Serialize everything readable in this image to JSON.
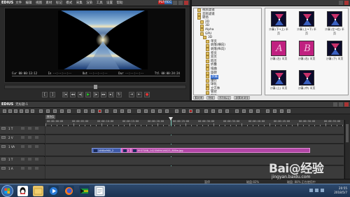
{
  "player": {
    "app_name": "EDIUS",
    "menu": [
      "文件",
      "编辑",
      "视图",
      "素材",
      "标记",
      "模式",
      "采集",
      "渲染",
      "工具",
      "设置",
      "帮助"
    ],
    "mode_badge_a": "PLR",
    "mode_badge_b": "REC",
    "timecodes": {
      "cur": "Cur 00:00:13:12",
      "in": "In --:--:--:--",
      "out": "Out --:--:--:--",
      "dur": "Dur --:--:--:--",
      "ttl": "Ttl 00:00:24:24"
    }
  },
  "effects": {
    "tree": [
      {
        "label": "视频滤镜",
        "indent": 5
      },
      {
        "label": "音频滤镜",
        "indent": 5
      },
      {
        "label": "转场",
        "indent": 5
      },
      {
        "label": "2D",
        "indent": 9
      },
      {
        "label": "3D",
        "indent": 9
      },
      {
        "label": "Alpha",
        "indent": 9
      },
      {
        "label": "GPU",
        "indent": 9
      },
      {
        "label": "3D",
        "indent": 13
      },
      {
        "label": "单页",
        "indent": 17
      },
      {
        "label": "剥落(横向)",
        "indent": 17
      },
      {
        "label": "剥落(纵向)",
        "indent": 17
      },
      {
        "label": "卷页",
        "indent": 17
      },
      {
        "label": "双页",
        "indent": 17
      },
      {
        "label": "四页",
        "indent": 17
      },
      {
        "label": "折叠",
        "indent": 17
      },
      {
        "label": "扭曲",
        "indent": 17
      },
      {
        "label": "旋转",
        "indent": 17
      },
      {
        "label": "沙漏",
        "indent": 17,
        "selected": true
      },
      {
        "label": "爆炸",
        "indent": 17
      },
      {
        "label": "球化",
        "indent": 17
      },
      {
        "label": "立方体",
        "indent": 17
      },
      {
        "label": "管状",
        "indent": 17
      },
      {
        "label": "翻页",
        "indent": 17
      },
      {
        "label": "门",
        "indent": 17
      }
    ],
    "thumbnails": [
      {
        "caption": "沙漏 (下→上) 半页",
        "kind": "hourglass"
      },
      {
        "caption": "沙漏 (上→下) 半页",
        "kind": "hourglass"
      },
      {
        "caption": "沙漏 (左→右) 半页",
        "kind": "hourglass"
      },
      {
        "caption": "沙漏 (左) 半页",
        "kind": "letterA",
        "letter": "A"
      },
      {
        "caption": "沙漏 (右) 半页",
        "kind": "letterB",
        "letter": "B"
      },
      {
        "caption": "沙漏 (下) 半页",
        "kind": "hourglass"
      },
      {
        "caption": "沙漏 (上) 半页",
        "kind": "hourglass"
      },
      {
        "caption": "沙漏 (中) 半页",
        "kind": "hourglass"
      }
    ],
    "footer_tabs": [
      "素材库",
      "特效",
      "序列标记",
      "源素材浏览"
    ]
  },
  "timeline": {
    "app_name": "EDIUS",
    "project": "无标题-1",
    "sequence_tab": "序列1",
    "playhead_tc": "00:00:13:12",
    "ruler_labels": [
      "00:00:00:00",
      "00:00:05:00",
      "00:00:10:00",
      "00:00:15:00",
      "00:00:20:00",
      "00:00:25:00",
      "00:00:30:00",
      "00:00:35:00",
      "00:00:40:00",
      "00:00:45:00",
      "00:00:50:00",
      "00:00:55:00"
    ],
    "tracks": [
      {
        "name": "1 T",
        "kind": "title"
      },
      {
        "name": "2 V",
        "kind": "video"
      },
      {
        "name": "1 VA",
        "kind": "videoaudio"
      },
      {
        "name": "1 T",
        "kind": "title"
      },
      {
        "name": "1 A",
        "kind": "audio"
      }
    ],
    "clips": [
      {
        "label": "1460x960_2",
        "color": "blue"
      },
      {
        "label": "2",
        "color": "pink"
      },
      {
        "label": "3937288_1423569416023_800w.jpg",
        "color": "pink2"
      }
    ],
    "status": {
      "left": "暂停",
      "mid": "磁盘:82%",
      "right": "磁盘: 88% 正在使用中"
    }
  },
  "taskbar": {
    "time": "20:55",
    "date": "2018/5/7"
  },
  "watermark": {
    "main": "Bai@经验",
    "sub": "jingyan.baidu.com"
  }
}
